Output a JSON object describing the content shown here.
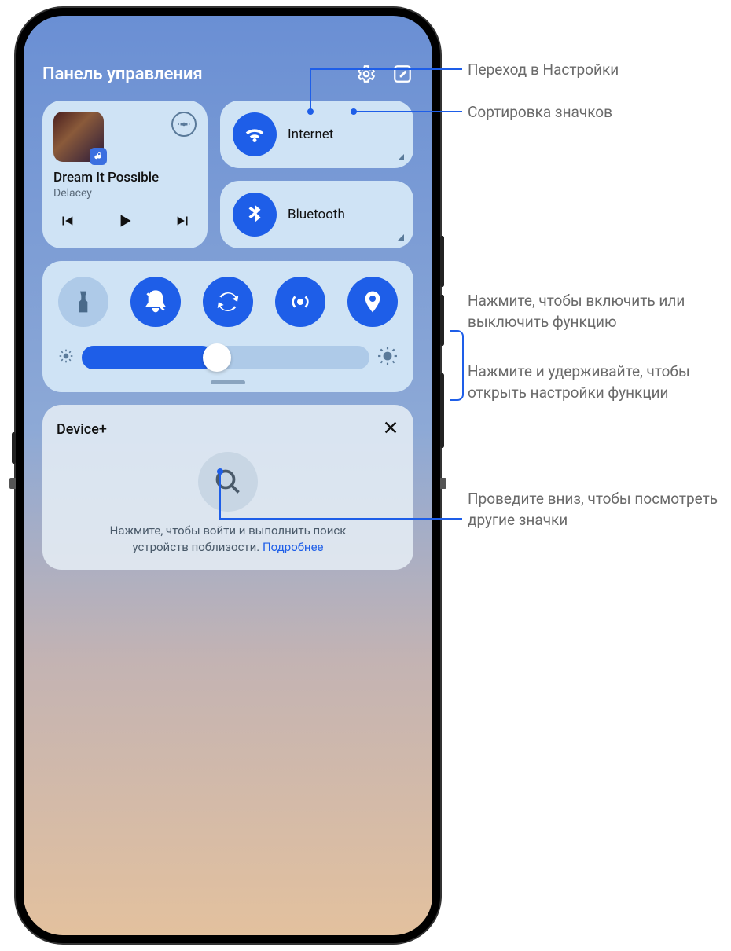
{
  "header": {
    "title": "Панель управления"
  },
  "media": {
    "track": "Dream It Possible",
    "artist": "Delacey"
  },
  "conn": {
    "wifi": "Internet",
    "bt": "Bluetooth"
  },
  "device": {
    "title": "Device+",
    "msg1": "Нажмите, чтобы войти и выполнить поиск",
    "msg2": "устройств поблизости. ",
    "link": "Подробнее"
  },
  "callouts": {
    "settings": "Переход в Настройки",
    "sort": "Сортировка значков",
    "tap": "Нажмите, чтобы включить или выключить функцию",
    "hold": "Нажмите и удерживайте, чтобы открыть настройки функции",
    "swipe": "Проведите вниз, чтобы посмотреть другие значки"
  }
}
